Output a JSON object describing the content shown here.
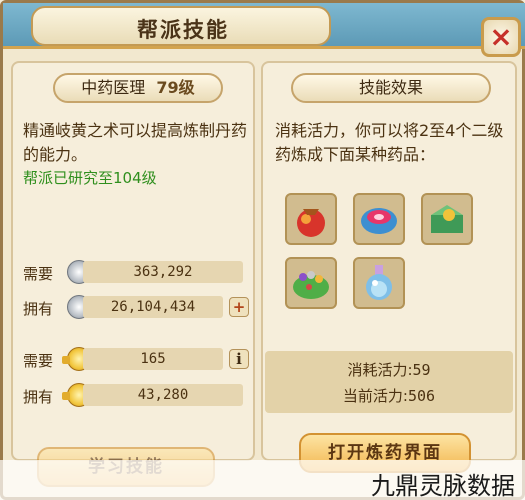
{
  "window": {
    "title": "帮派技能",
    "close_label": "×"
  },
  "skill": {
    "name": "中药医理",
    "level": "79级",
    "description": "精通岐黄之术可以提高炼制丹药的能力。",
    "research_status": "帮派已研究至104级"
  },
  "resources": [
    {
      "label": "需要",
      "value": "363,292",
      "icon": "silver-coin-icon"
    },
    {
      "label": "拥有",
      "value": "26,104,434",
      "icon": "silver-coin-icon",
      "button": "+"
    },
    {
      "label": "需要",
      "value": "165",
      "icon": "gold-coin-icon",
      "button": "i"
    },
    {
      "label": "拥有",
      "value": "43,280",
      "icon": "gold-coin-icon"
    }
  ],
  "effect": {
    "heading": "技能效果",
    "description": "消耗活力，你可以将2至4个二级药炼成下面某种药品：",
    "items": [
      {
        "name": "pouch-medicine-icon"
      },
      {
        "name": "crystal-bowl-icon"
      },
      {
        "name": "jade-box-icon"
      },
      {
        "name": "pearl-leaf-icon"
      },
      {
        "name": "potion-bottle-icon"
      }
    ],
    "stats": {
      "cost_label": "消耗活力:",
      "cost_value": "59",
      "current_label": "当前活力:",
      "current_value": "506"
    }
  },
  "buttons": {
    "learn": "学习技能",
    "open_alchemy": "打开炼药界面"
  },
  "watermark": "九鼎灵脉数据"
}
